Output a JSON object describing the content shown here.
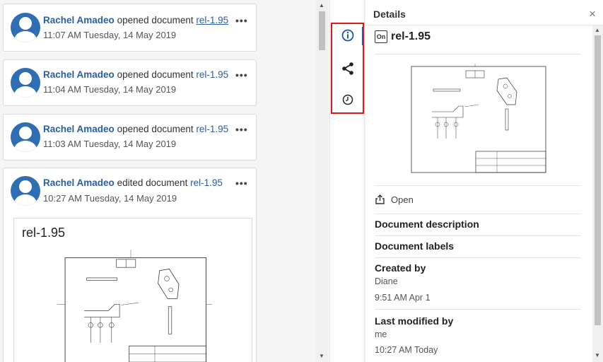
{
  "feed": {
    "items": [
      {
        "user": "Rachel Amadeo",
        "action": "opened document",
        "doc": "rel-1.95",
        "time": "11:07 AM Tuesday, 14 May 2019",
        "more": "•••"
      },
      {
        "user": "Rachel Amadeo",
        "action": "opened document",
        "doc": "rel-1.95",
        "time": "11:04 AM Tuesday, 14 May 2019",
        "more": "•••"
      },
      {
        "user": "Rachel Amadeo",
        "action": "opened document",
        "doc": "rel-1.95",
        "time": "11:03 AM Tuesday, 14 May 2019",
        "more": "•••"
      },
      {
        "user": "Rachel Amadeo",
        "action": "edited document",
        "doc": "rel-1.95",
        "time": "10:27 AM Tuesday, 14 May 2019",
        "more": "•••",
        "preview_title": "rel-1.95"
      }
    ]
  },
  "rail": {
    "icons": [
      "info-icon",
      "share-icon",
      "clock-icon"
    ],
    "accent": "#1e5aa6",
    "highlight_color": "#e01818"
  },
  "details": {
    "title": "Details",
    "close": "×",
    "doc_badge": "On",
    "doc_name": "rel-1.95",
    "open_label": "Open",
    "description_label": "Document description",
    "labels_label": "Document labels",
    "created_by_label": "Created by",
    "created_by": "Diane",
    "created_time": "9:51 AM Apr 1",
    "modified_by_label": "Last modified by",
    "modified_by": "me",
    "modified_time": "10:27 AM Today"
  }
}
